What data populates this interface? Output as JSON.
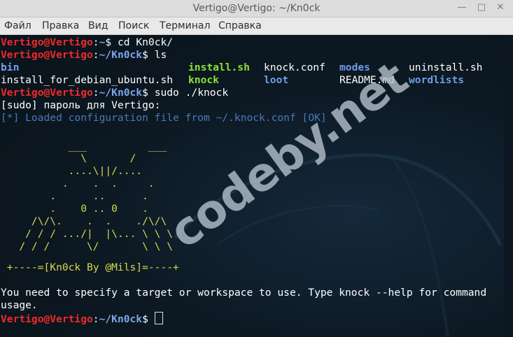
{
  "window": {
    "title": "Vertigo@Vertigo: ~/Kn0ck",
    "buttons": {
      "minimize": "—",
      "maximize": "□",
      "close": "✕"
    }
  },
  "menu": [
    "Файл",
    "Правка",
    "Вид",
    "Поиск",
    "Терминал",
    "Справка"
  ],
  "prompt": {
    "user": "Vertigo@Vertigo",
    "sep": ":",
    "home_path": "~",
    "dir_path": "~/Kn0ck",
    "sigil": "$"
  },
  "commands": {
    "cmd1": " cd Kn0ck/",
    "cmd2": " ls",
    "cmd3": " sudo ./knock"
  },
  "ls_output": {
    "row1": [
      "bin",
      "install.sh",
      "knock.conf",
      "modes",
      "uninstall.sh"
    ],
    "row2": [
      "install_for_debian_ubuntu.sh",
      "knock",
      "loot",
      "README.md",
      "wordlists"
    ]
  },
  "sudo_prompt": "[sudo] пароль для Vertigo:",
  "info_line": {
    "prefix": "[*] Loaded configuration file from ~/.knock.conf [",
    "ok": "OK",
    "suffix": "]"
  },
  "ascii_art": [
    "           ___          ___",
    "             \\       /",
    "           ....\\||/....",
    "          .    .  .     .",
    "        .      ..      .",
    "        .    0 .. 0    .",
    "     /\\/\\.    .  .    ./\\/\\",
    "    / / / .../|  |\\... \\ \\ \\",
    "   / / /      \\/       \\ \\ \\"
  ],
  "banner": " +----=[Kn0ck By @Mils]=----+",
  "message_line1": "You need to specify a target or workspace to use. Type knock --help for command",
  "message_line2": "usage.",
  "watermark": "codeby.net",
  "colors": {
    "user": "#ef2929",
    "path": "#7aa6e8",
    "exec": "#8ae234",
    "dir": "#6e9ce9",
    "ascii": "#d8d84a",
    "background": "#0d1a24"
  }
}
